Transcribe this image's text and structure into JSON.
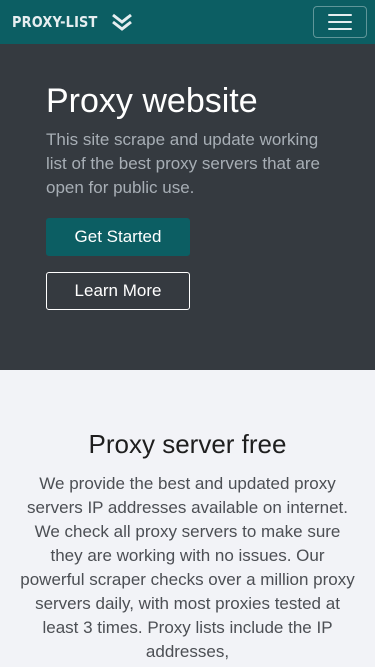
{
  "navbar": {
    "brand_text": "PROXY-LIST",
    "brand_icon": "double-chevron-down-icon",
    "menu_icon": "hamburger-icon"
  },
  "hero": {
    "title": "Proxy website",
    "description": "This site scrape and update working list of the best proxy servers that are open for public use.",
    "primary_button": "Get Started",
    "secondary_button": "Learn More"
  },
  "section": {
    "heading": "Proxy server free",
    "body": "We provide the best and updated proxy servers IP addresses available on internet. We check all proxy servers to make sure they are working with no issues. Our powerful scraper checks over a million proxy servers daily, with most proxies tested at least 3 times. Proxy lists include the IP addresses,"
  },
  "colors": {
    "navbar_bg": "#0c5e63",
    "hero_bg": "#353a40",
    "primary_button": "#0c5e63",
    "page_bg": "#f2f3f7"
  }
}
